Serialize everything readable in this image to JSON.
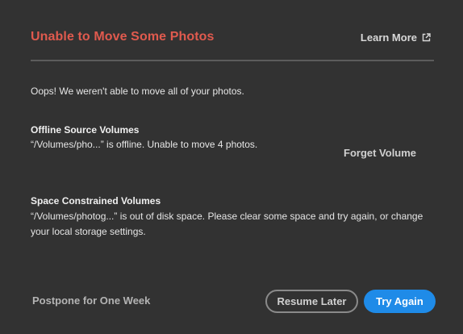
{
  "dialog": {
    "title": "Unable to Move Some Photos",
    "learn_more": "Learn More",
    "intro": "Oops! We weren't able to move all of your photos.",
    "offline": {
      "heading": "Offline Source Volumes",
      "message": "“/Volumes/pho...” is offline. Unable to move 4 photos.",
      "action": "Forget Volume"
    },
    "space": {
      "heading": "Space Constrained Volumes",
      "message": "“/Volumes/photog...” is out of disk space. Please clear some space and try again, or change your local storage settings."
    },
    "footer": {
      "postpone": "Postpone for One Week",
      "resume_later": "Resume Later",
      "try_again": "Try Again"
    }
  },
  "icons": {
    "learn_more": "external-link-icon"
  },
  "colors": {
    "background": "#323232",
    "title": "#e05a4e",
    "primary_button": "#1f8be8",
    "divider": "#5c5c5c"
  }
}
